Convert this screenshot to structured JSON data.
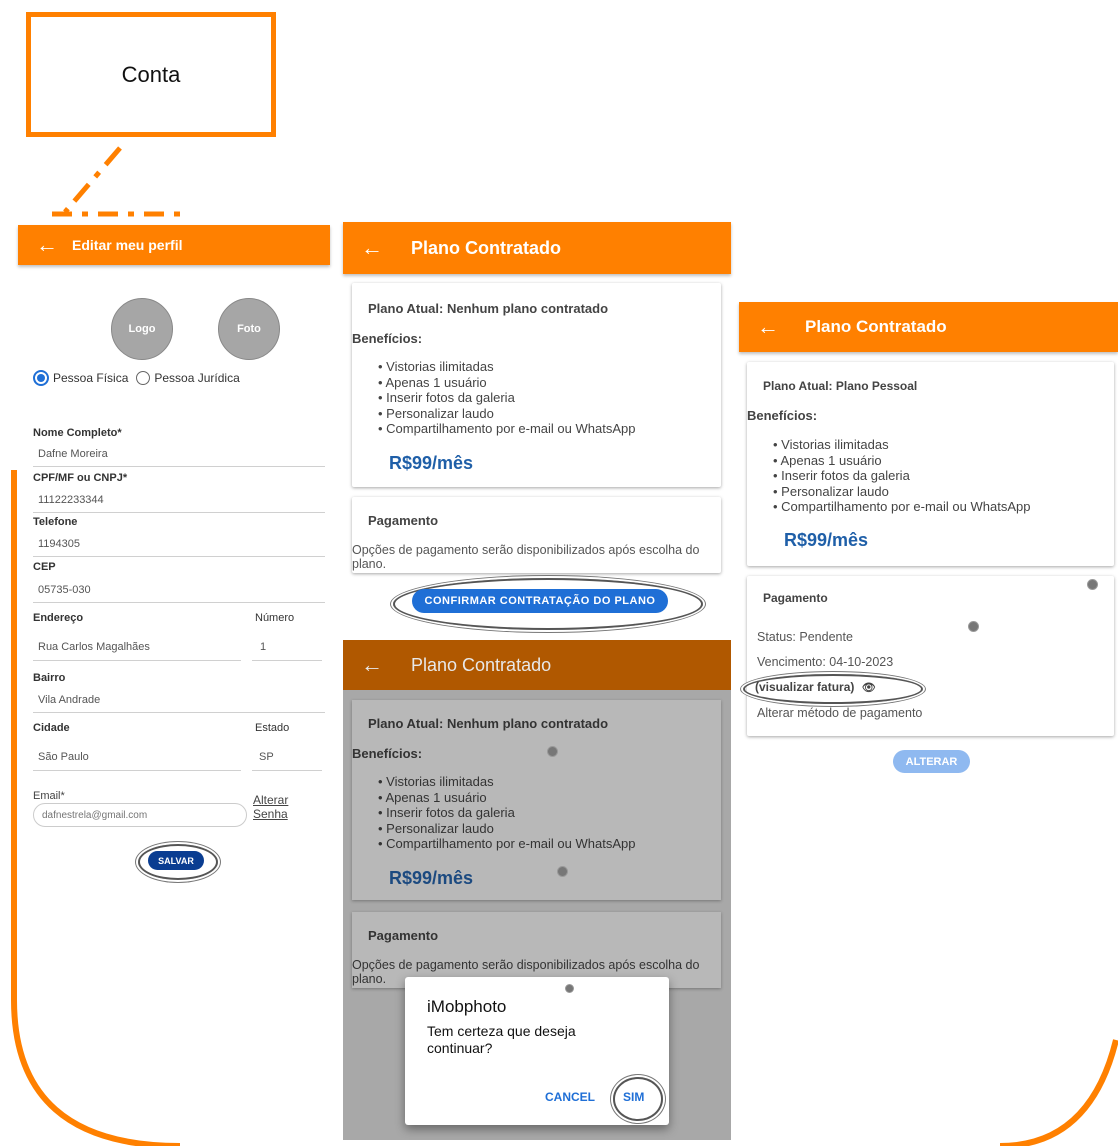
{
  "annotation": {
    "label": "Conta"
  },
  "profile": {
    "title": "Editar meu perfil",
    "logo_label": "Logo",
    "photo_label": "Foto",
    "radio_fisica": "Pessoa Física",
    "radio_juridica": "Pessoa Jurídica",
    "fields": {
      "nome_label": "Nome Completo*",
      "nome_value": "Dafne Moreira",
      "cpf_label": "CPF/MF ou CNPJ*",
      "cpf_value": "11122233344",
      "tel_label": "Telefone",
      "tel_value": "1194305",
      "cep_label": "CEP",
      "cep_value": "05735-030",
      "endereco_label": "Endereço",
      "endereco_value": "Rua Carlos Magalhães",
      "numero_label": "Número",
      "numero_value": "1",
      "bairro_label": "Bairro",
      "bairro_value": "Vila Andrade",
      "cidade_label": "Cidade",
      "cidade_value": "São Paulo",
      "estado_label": "Estado",
      "estado_value": "SP",
      "email_label": "Email*",
      "email_placeholder": "dafnestrela@gmail.com"
    },
    "alterar_link": "Alterar",
    "senha_link": "Senha",
    "save_button": "SALVAR"
  },
  "plan_screen": {
    "title": "Plano Contratado",
    "plan_current": "Plano Atual: Nenhum plano contratado",
    "benefits_label": "Benefícios:",
    "benefits": [
      "Vistorias ilimitadas",
      "Apenas 1 usuário",
      "Inserir fotos da galeria",
      "Personalizar laudo",
      "Compartilhamento por e-mail ou WhatsApp"
    ],
    "price": "R$99/mês",
    "payment_title": "Pagamento",
    "payment_text": "Opções de pagamento serão disponibilizados após escolha do plano.",
    "confirm_button": "CONFIRMAR CONTRATAÇÃO DO PLANO"
  },
  "dialog": {
    "title": "iMobphoto",
    "message": "Tem certeza que deseja continuar?",
    "cancel": "CANCEL",
    "confirm": "SIM"
  },
  "plan_active": {
    "title": "Plano Contratado",
    "plan_current": "Plano Atual: Plano Pessoal",
    "benefits_label": "Benefícios:",
    "price": "R$99/mês",
    "payment_title": "Pagamento",
    "status": "Status: Pendente",
    "due": "Vencimento: 04-10-2023",
    "invoice_link": "(visualizar fatura)",
    "change_method": "Alterar método de pagamento",
    "alter_button": "ALTERAR"
  },
  "colors": {
    "accent": "#ff8000",
    "primary_blue": "#1f6fd6",
    "price_blue": "#1f5fa8"
  }
}
